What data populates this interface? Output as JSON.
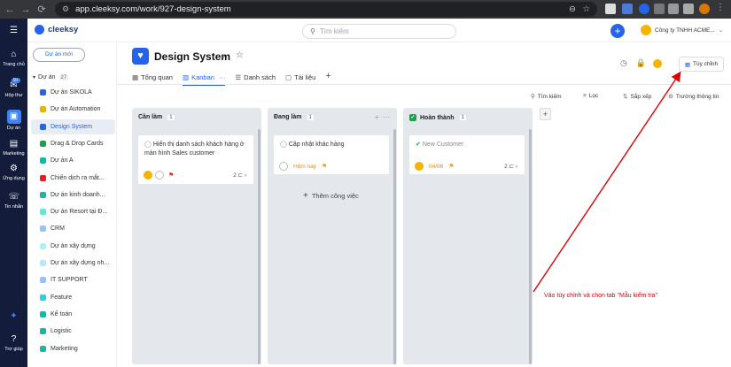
{
  "browser": {
    "url": "app.cleeksy.com/work/927-design-system"
  },
  "header": {
    "logo": "cleeksy",
    "search_placeholder": "Tìm kiếm",
    "company": "Công ty TNHH ACME..."
  },
  "leftnav": [
    {
      "label": "Trang chủ",
      "icon": "home-icon"
    },
    {
      "label": "Hộp thư",
      "icon": "inbox-icon",
      "badge": "9+"
    },
    {
      "label": "Dự án",
      "icon": "folder-icon"
    },
    {
      "label": "Marketing",
      "icon": "book-icon"
    },
    {
      "label": "Ứng dụng",
      "icon": "apps-icon"
    },
    {
      "label": "Tin nhắn",
      "icon": "chat-icon"
    },
    {
      "label": "Trợ giúp",
      "icon": "help-icon"
    }
  ],
  "sidebar": {
    "new_project": "Dự án mới",
    "projects_label": "Dự án",
    "projects_count": "27",
    "items": [
      {
        "label": "Dự án SIKOLA",
        "color": "#2563eb"
      },
      {
        "label": "Dự án Automation",
        "color": "#eab308"
      },
      {
        "label": "Design System",
        "color": "#2563eb"
      },
      {
        "label": "Drag & Drop Cards",
        "color": "#16a34a"
      },
      {
        "label": "Dự án A",
        "color": "#14b8a6"
      },
      {
        "label": "Chiến dịch ra mắt...",
        "color": "#dc2626"
      },
      {
        "label": "Dự án kinh doanh...",
        "color": "#14b8a6"
      },
      {
        "label": "Dự án Resort tại Đ...",
        "color": "#5eead4"
      },
      {
        "label": "CRM",
        "color": "#93c5fd"
      },
      {
        "label": "Dự án xây dựng",
        "color": "#a5f3fc"
      },
      {
        "label": "Dự án xây dựng nh...",
        "color": "#bae6fd"
      },
      {
        "label": "IT SUPPORT",
        "color": "#93c5fd"
      },
      {
        "label": "Feature",
        "color": "#22d3ee"
      },
      {
        "label": "Kế toán",
        "color": "#14b8a6"
      },
      {
        "label": "Logistic",
        "color": "#14b8a6"
      },
      {
        "label": "Marketing",
        "color": "#14b8a6"
      }
    ]
  },
  "main": {
    "title": "Design System",
    "customize": "Tùy chỉnh",
    "tabs": [
      "Tổng quan",
      "Kanban",
      "Danh sách",
      "Tài liệu"
    ],
    "tools": {
      "search": "Tìm kiếm",
      "filter": "Lọc",
      "sort": "Sắp xếp",
      "fields": "Trường thông tin"
    },
    "columns": [
      {
        "title": "Cần làm",
        "count": "1"
      },
      {
        "title": "Đang làm",
        "count": "1"
      },
      {
        "title": "Hoàn thành",
        "count": "1"
      }
    ],
    "cards": [
      {
        "title": "Hiển thị danh sách khách hàng ở màn hình Sales customer",
        "subtasks": "2"
      },
      {
        "title": "Cập nhật khác hàng",
        "due": "Hôm nay"
      },
      {
        "title": "New Customer",
        "due": "04/06",
        "subtasks": "2"
      }
    ],
    "add_task": "Thêm công việc"
  },
  "annotation": "Vào tùy chỉnh và chọn tab \"Mẫu kiểm tra\"",
  "colors": {
    "accent": "#2563eb",
    "nav_bg": "#141c3c",
    "annotation": "#e00000"
  }
}
